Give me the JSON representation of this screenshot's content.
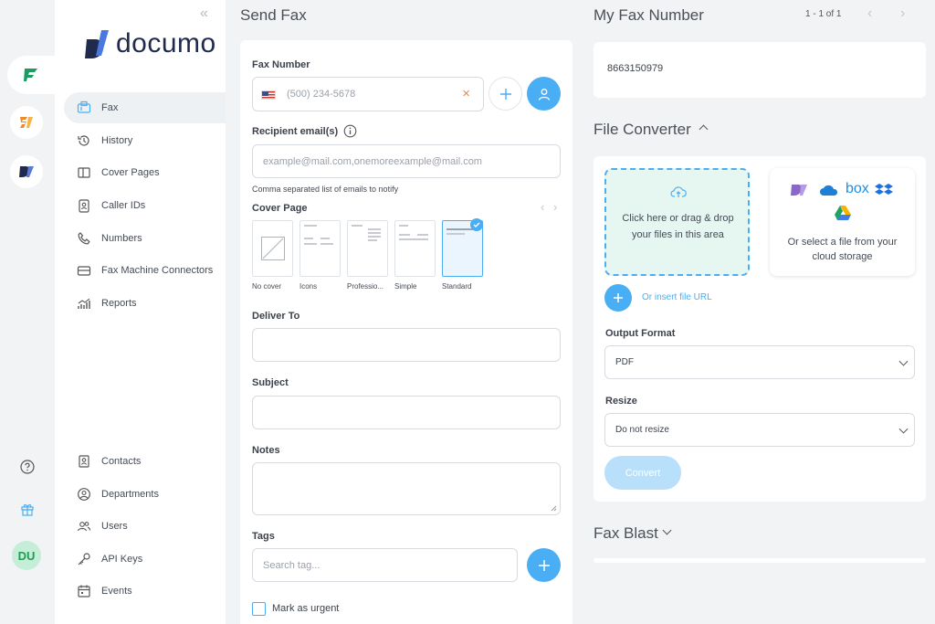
{
  "sidebar": {
    "brand": "documo",
    "items": [
      {
        "label": "Fax",
        "icon": "fax-icon"
      },
      {
        "label": "History",
        "icon": "history-icon"
      },
      {
        "label": "Cover Pages",
        "icon": "cover-pages-icon"
      },
      {
        "label": "Caller IDs",
        "icon": "caller-id-icon"
      },
      {
        "label": "Numbers",
        "icon": "phone-icon"
      },
      {
        "label": "Fax Machine Connectors",
        "icon": "fax-connector-icon"
      },
      {
        "label": "Reports",
        "icon": "reports-icon"
      }
    ],
    "bottom_items": [
      {
        "label": "Contacts",
        "icon": "contacts-icon"
      },
      {
        "label": "Departments",
        "icon": "departments-icon"
      },
      {
        "label": "Users",
        "icon": "users-icon"
      },
      {
        "label": "API Keys",
        "icon": "key-icon"
      },
      {
        "label": "Events",
        "icon": "events-icon"
      }
    ]
  },
  "rail": {
    "avatar_initials": "DU"
  },
  "send_fax": {
    "title": "Send Fax",
    "fax_number_label": "Fax Number",
    "fax_number_placeholder": "(500) 234-5678",
    "recipient_label": "Recipient email(s)",
    "recipient_placeholder": "example@mail.com,onemoreexample@mail.com",
    "recipient_hint": "Comma separated list of emails to notify",
    "cover_page_label": "Cover Page",
    "covers": [
      "No cover",
      "Icons",
      "Professio...",
      "Simple",
      "Standard"
    ],
    "selected_cover": "Standard",
    "deliver_to_label": "Deliver To",
    "subject_label": "Subject",
    "notes_label": "Notes",
    "tags_label": "Tags",
    "tags_placeholder": "Search tag...",
    "urgent_label": "Mark as urgent"
  },
  "my_fax_number": {
    "title": "My Fax Number",
    "pagination": "1 - 1 of 1",
    "number": "8663150979"
  },
  "file_converter": {
    "title": "File Converter",
    "dropzone_text": "Click here or drag & drop your files in this area",
    "cloud_text": "Or select a file from your cloud storage",
    "cloud_box_label": "box",
    "insert_url": "Or insert file URL",
    "output_format_label": "Output Format",
    "output_format_value": "PDF",
    "resize_label": "Resize",
    "resize_value": "Do not resize",
    "convert_label": "Convert"
  },
  "fax_blast": {
    "title": "Fax Blast"
  },
  "colors": {
    "accent": "#4aaef4",
    "dropzone_bg": "#e6f6f0",
    "convert_disabled": "#b9e0fb"
  }
}
